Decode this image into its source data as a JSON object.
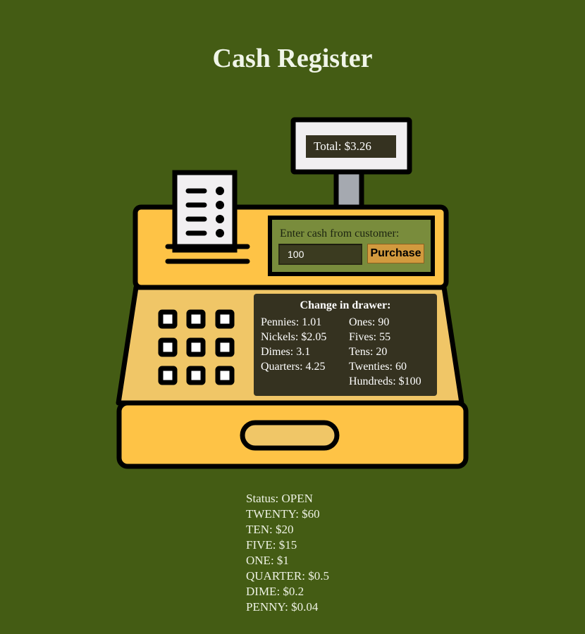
{
  "page": {
    "title": "Cash Register"
  },
  "colors": {
    "background": "#445c14",
    "register_body": "#fec346",
    "register_lower": "#f0c667",
    "display_panel": "#353220",
    "input_panel": "#798c3c",
    "button_accent": "#d29a3e",
    "outline": "#000000"
  },
  "register": {
    "total_display": "Total: $3.26",
    "cash_input": {
      "label": "Enter cash from customer:",
      "value": "100",
      "placeholder": ""
    },
    "purchase_button_label": "Purchase",
    "receipt_icon": "receipt-icon",
    "keypad_icon": "keypad-icon"
  },
  "drawer": {
    "title": "Change in drawer:",
    "left_column": [
      "Pennies: 1.01",
      "Nickels: $2.05",
      "Dimes: 3.1",
      "Quarters: 4.25"
    ],
    "right_column": [
      "Ones: 90",
      "Fives: 55",
      "Tens: 20",
      "Twenties: 60",
      "Hundreds: $100"
    ]
  },
  "result": {
    "status": "Status: OPEN",
    "change_lines": [
      "TWENTY: $60",
      "TEN: $20",
      "FIVE: $15",
      "ONE: $1",
      "QUARTER: $0.5",
      "DIME: $0.2",
      "PENNY: $0.04"
    ]
  }
}
